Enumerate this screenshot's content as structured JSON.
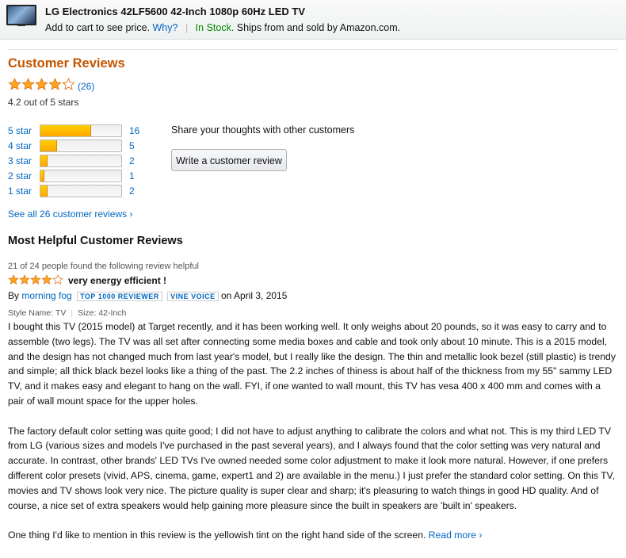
{
  "header": {
    "title": "LG Electronics 42LF5600 42-Inch 1080p 60Hz LED TV",
    "price_text": "Add to cart to see price.",
    "why_link": "Why?",
    "stock": "In Stock.",
    "ships": "Ships from and sold by Amazon.com."
  },
  "reviews_summary": {
    "heading": "Customer Reviews",
    "count_label": "(26)",
    "average_text": "4.2 out of 5 stars",
    "rating": 4.2,
    "histogram": [
      {
        "label": "5 star",
        "count": "16",
        "fraction": 0.615
      },
      {
        "label": "4 star",
        "count": "5",
        "fraction": 0.192
      },
      {
        "label": "3 star",
        "count": "2",
        "fraction": 0.077
      },
      {
        "label": "2 star",
        "count": "1",
        "fraction": 0.038
      },
      {
        "label": "1 star",
        "count": "2",
        "fraction": 0.077
      }
    ],
    "share_text": "Share your thoughts with other customers",
    "write_button": "Write a customer review",
    "see_all": "See all 26 customer reviews ›"
  },
  "helpful": {
    "heading": "Most Helpful Customer Reviews",
    "review": {
      "helpful_votes": "21 of 24 people found the following review helpful",
      "rating": 4,
      "title": "very energy efficient !",
      "by": "By",
      "author": "morning fog",
      "badge1": "TOP 1000 REVIEWER",
      "badge2": "VINE VOICE",
      "date": "on April 3, 2015",
      "style_name": "Style Name: TV",
      "size": "Size: 42-Inch",
      "para1": "I bought this TV (2015 model) at Target recently, and it has been working well. It only weighs about 20 pounds, so it was easy to carry and to assemble (two legs). The TV was all set after connecting some media boxes and cable and took only about 10 minute. This is a 2015 model, and the design has not changed much from last year's model, but I really like the design. The thin and metallic look bezel (still plastic) is trendy and simple; all thick black bezel looks like a thing of the past. The 2.2 inches of thiness is about half of the thickness from my 55\" sammy LED TV, and it makes easy and elegant to hang on the wall. FYI, if one wanted to wall mount, this TV has vesa 400 x 400 mm and comes with a pair of wall mount space for the upper holes.",
      "para2": "The factory default color setting was quite good; I did not have to adjust anything to calibrate the colors and what not. This is my third LED TV from LG (various sizes and models I've purchased in the past several years), and I always found that the color setting was very natural and accurate. In contrast, other brands' LED TVs I've owned needed some color adjustment to make it look more natural. However, if one prefers different color presets (vivid, APS, cinema, game, expert1 and 2) are available in the menu.) I just prefer the standard color setting. On this TV, movies and TV shows look very nice. The picture quality is super clear and sharp; it's pleasuring to watch things in good HD quality. And of course, a nice set of extra speakers would help gaining more pleasure since the built in speakers are 'built in' speakers.",
      "para3": "One thing I'd like to mention in this review is the yellowish tint on the right hand side of the screen.",
      "read_more": "Read more ›"
    }
  },
  "colors": {
    "star": "#ffa41c",
    "heading": "#c45500",
    "link": "#0066c0",
    "stock": "#008a00"
  }
}
